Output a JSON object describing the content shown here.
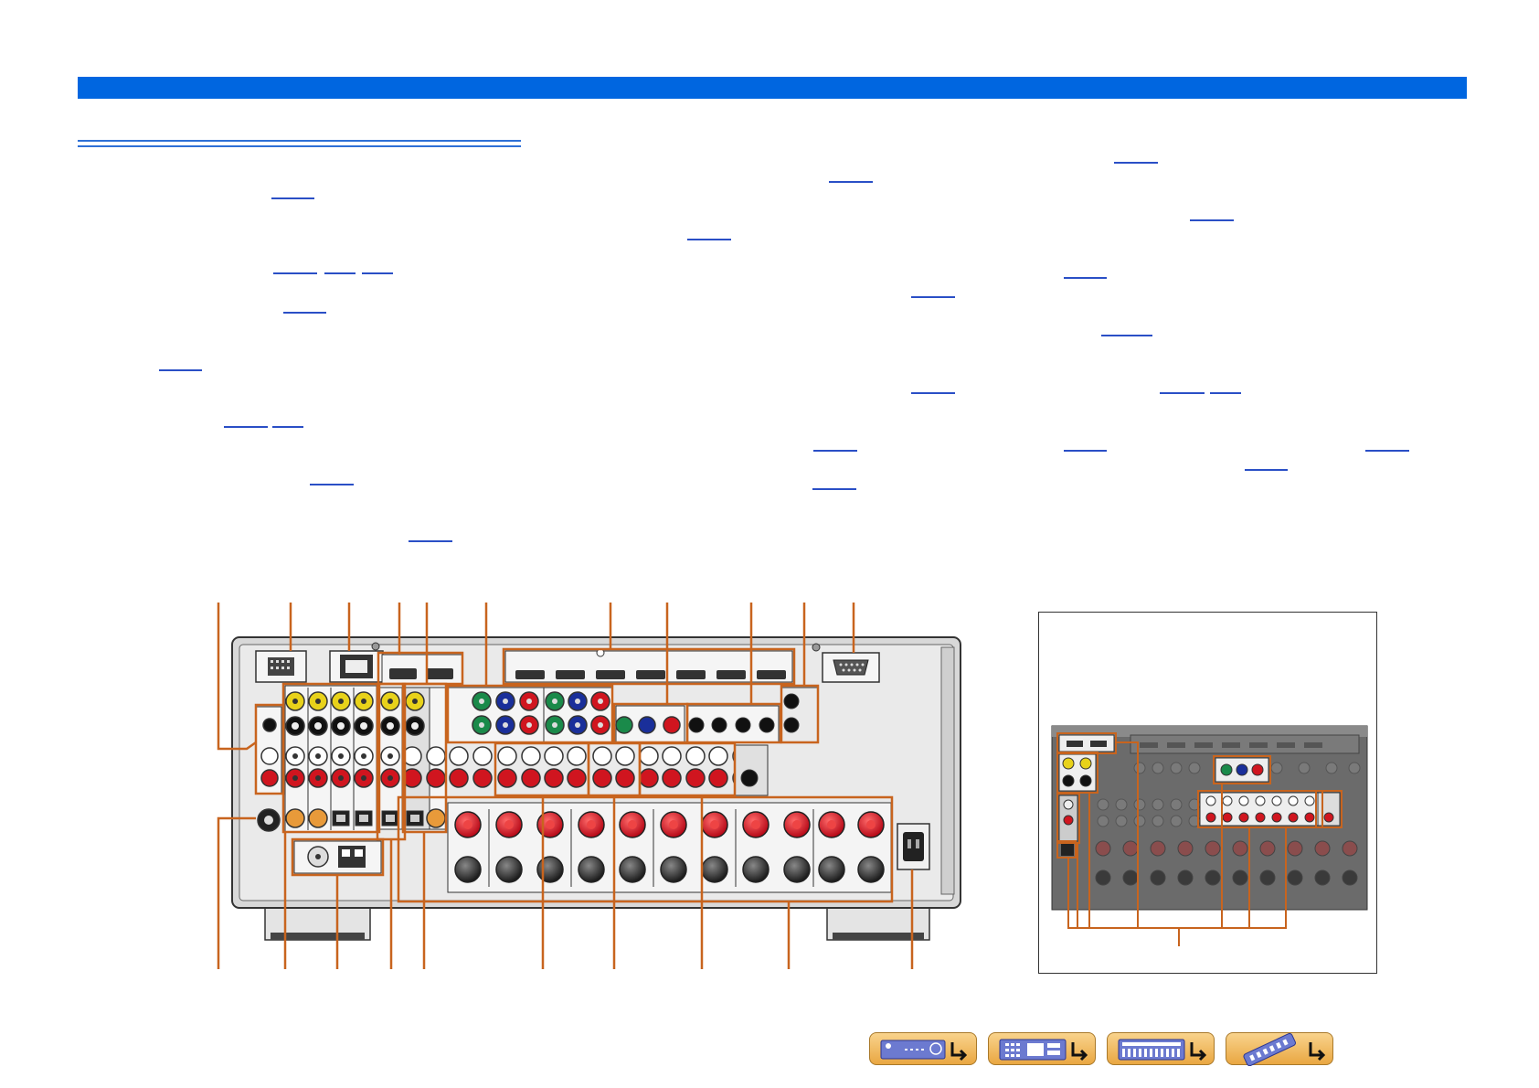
{
  "header": {
    "title": ""
  },
  "section": {
    "title": ""
  },
  "body_text": [],
  "diagram": {
    "main_caption": "",
    "inset_caption": "",
    "accent_color": "#c8641e",
    "chassis_color": "#d8d8d8",
    "panel_color": "#f4f4f4",
    "jack_colors": {
      "video": "#e8d21a",
      "red": "#d0151f",
      "white": "#ffffff",
      "green": "#1a8a4a",
      "blue": "#1a2f9a",
      "black": "#222222"
    }
  },
  "navigation": [
    {
      "name": "front-panel",
      "icon": "receiver-front-icon"
    },
    {
      "name": "front-display",
      "icon": "display-grid-icon"
    },
    {
      "name": "rear-panel",
      "icon": "rear-panel-icon"
    },
    {
      "name": "remote-control",
      "icon": "remote-control-icon"
    }
  ]
}
